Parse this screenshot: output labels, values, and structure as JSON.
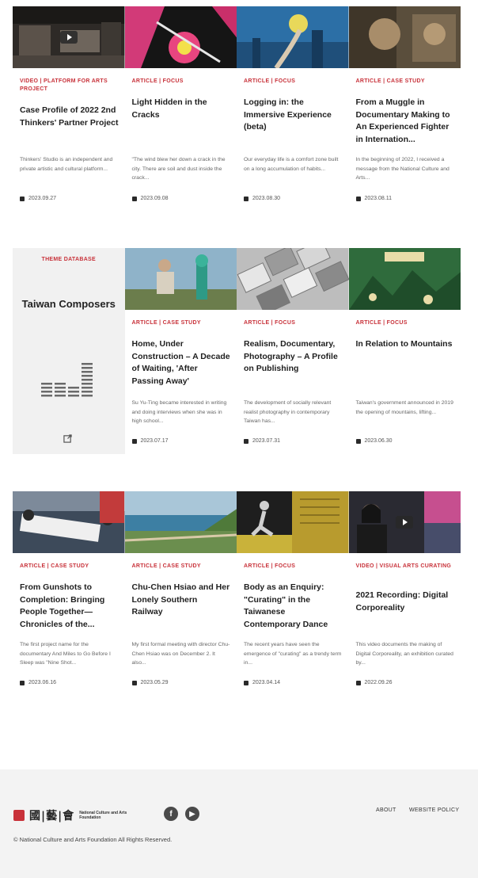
{
  "rows": [
    [
      {
        "category": "VIDEO | PLATFORM FOR ARTS PROJECT",
        "title": "Case Profile of 2022 2nd Thinkers' Partner Project",
        "excerpt": "Thinkers' Studio is an independent and private artistic and cultural platform...",
        "date": "2023.09.27",
        "thumb": "video",
        "has_play": true
      },
      {
        "category": "ARTICLE | FOCUS",
        "title": "Light Hidden in the Cracks",
        "excerpt": "\"The wind blew her down a crack in the city. There are soil and dust inside the crack...",
        "date": "2023.09.08",
        "thumb": "flower"
      },
      {
        "category": "ARTICLE | FOCUS",
        "title": "Logging in: the Immersive Experience (beta)",
        "excerpt": "Our everyday life is a comfort zone built on a long accumulation of habits...",
        "date": "2023.08.30",
        "thumb": "blue"
      },
      {
        "category": "ARTICLE | CASE STUDY",
        "title": "From a Muggle in Documentary Making to An Experienced Fighter in Internation...",
        "excerpt": "In the beginning of 2022, I received a message from the National Culture and Arts...",
        "date": "2023.08.11",
        "thumb": "sepia"
      }
    ],
    [
      {
        "category": "ARTICLE | CASE STUDY",
        "title": "Home, Under Construction – A Decade of Waiting, 'After Passing Away'",
        "excerpt": "Su Yu-Ting became interested in writing and doing interviews when she was in high school...",
        "date": "2023.07.17",
        "thumb": "field"
      },
      {
        "category": "ARTICLE | FOCUS",
        "title": "Realism, Documentary, Photography – A Profile on Publishing",
        "excerpt": "The development of socially relevant realist photography in contemporary Taiwan has...",
        "date": "2023.07.31",
        "thumb": "photos"
      },
      {
        "category": "ARTICLE | FOCUS",
        "title": "In Relation to Mountains",
        "excerpt": "Taiwan's government announced in 2019 the opening of mountains, lifting...",
        "date": "2023.06.30",
        "thumb": "mountain"
      }
    ],
    [
      {
        "category": "ARTICLE | CASE STUDY",
        "title": "From Gunshots to Completion: Bringing People Together— Chronicles of the...",
        "excerpt": "The first project name for the documentary And Miles to Go Before I Sleep was \"Nine Shot...",
        "date": "2023.06.16",
        "thumb": "protest"
      },
      {
        "category": "ARTICLE | CASE STUDY",
        "title": "Chu-Chen Hsiao and Her Lonely Southern Railway",
        "excerpt": "My first formal meeting with director Chu-Chen Hsiao was on December 2. It also...",
        "date": "2023.05.29",
        "thumb": "coast"
      },
      {
        "category": "ARTICLE | FOCUS",
        "title": "Body as an Enquiry: \"Curating\" in the Taiwanese Contemporary Dance",
        "excerpt": "The recent years have seen the emergence of \"curating\" as a trendy term in...",
        "date": "2023.04.14",
        "thumb": "dance"
      },
      {
        "category": "VIDEO | VISUAL ARTS CURATING",
        "title": "2021 Recording: Digital Corporeality",
        "excerpt": "This video documents the making of Digital Corporeality, an exhibition curated by...",
        "date": "2022.09.26",
        "thumb": "portrait",
        "has_play": true
      }
    ]
  ],
  "theme_card": {
    "tag": "THEME DATABASE",
    "title": "Taiwan Composers",
    "icon": "external-link-icon"
  },
  "footer": {
    "logo_cjk": "國|藝|會",
    "logo_en": "National Culture and Arts Foundation",
    "social": [
      {
        "name": "facebook-icon",
        "glyph": "f"
      },
      {
        "name": "youtube-icon",
        "glyph": "▶"
      }
    ],
    "links": [
      "ABOUT",
      "WEBSITE POLICY"
    ],
    "copyright": "© National Culture and Arts Foundation All Rights Reserved."
  },
  "colors": {
    "accent": "#c8323a",
    "footer_bg": "#f3f3f3",
    "theme_bg": "#f1f1f1"
  }
}
